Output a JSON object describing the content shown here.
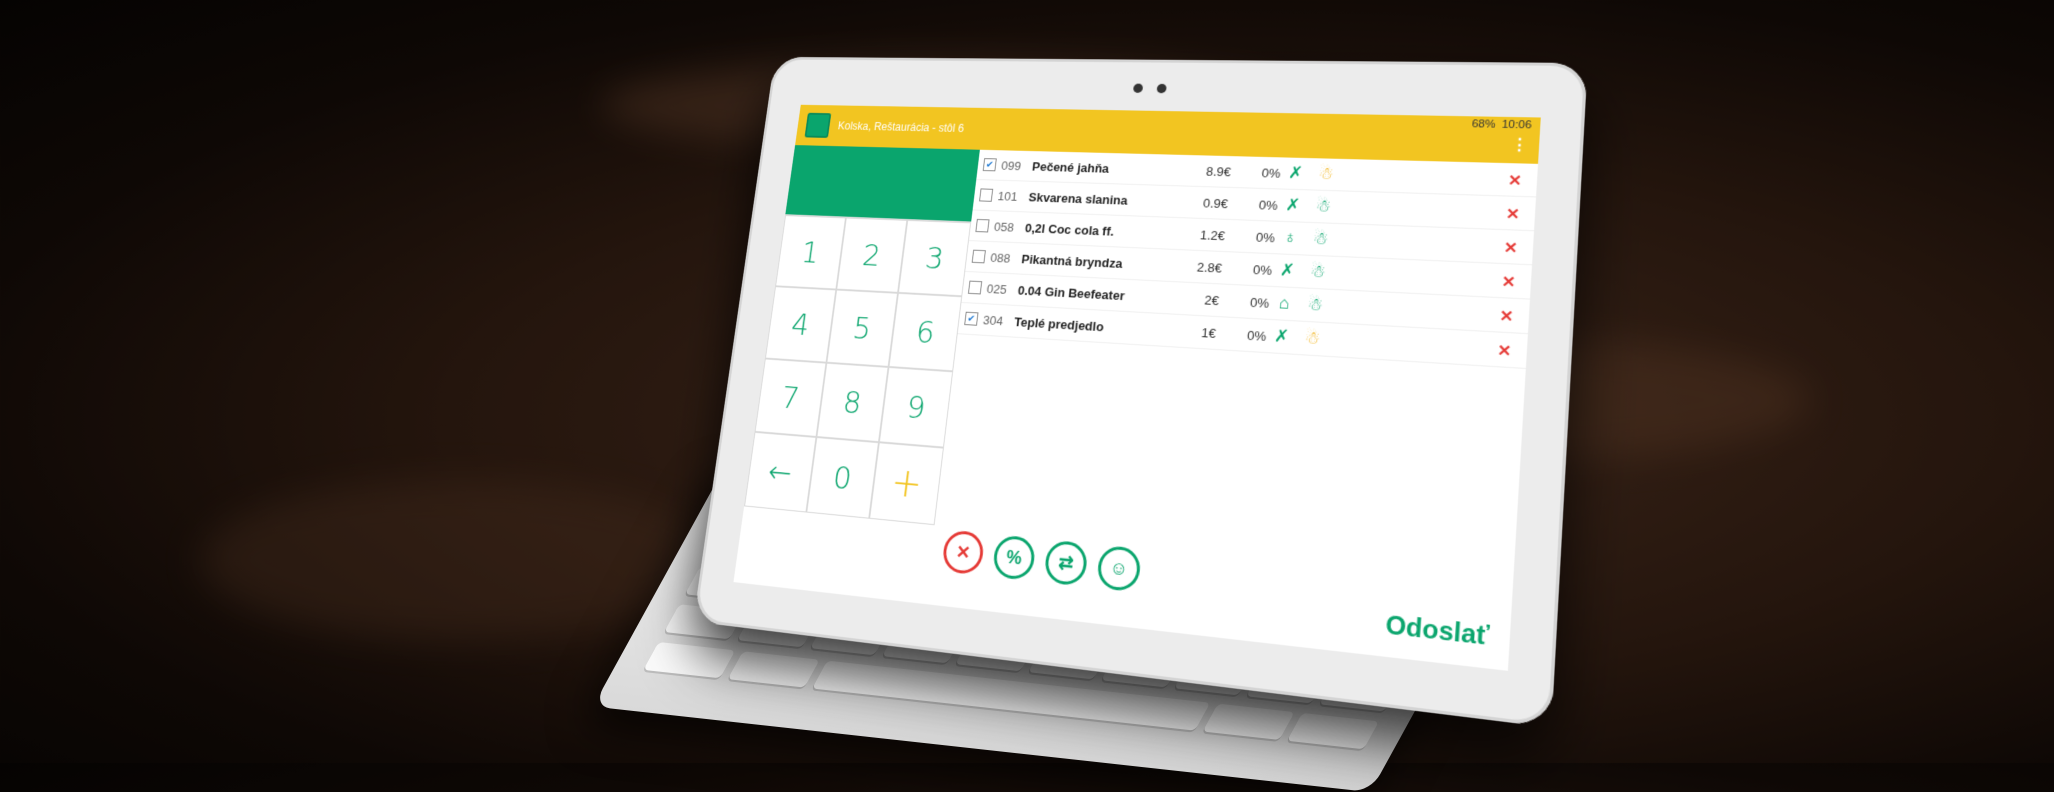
{
  "app": {
    "title": "Kolska, Reštaurácia - stôl 6",
    "time": "10:06",
    "battery": "68%",
    "menu_icon": "more-vert-icon"
  },
  "keypad": {
    "keys": [
      "1",
      "2",
      "3",
      "4",
      "5",
      "6",
      "7",
      "8",
      "9",
      "←",
      "0",
      "+"
    ]
  },
  "orders": [
    {
      "checked": true,
      "code": "099",
      "name": "Pečené jahňa",
      "price": "8.9€",
      "discount": "0%",
      "icons": [
        "fork-knife-icon",
        "person-yellow-icon"
      ]
    },
    {
      "checked": false,
      "code": "101",
      "name": "Skvarena slanina",
      "price": "0.9€",
      "discount": "0%",
      "icons": [
        "fork-knife-icon",
        "person-green-icon"
      ]
    },
    {
      "checked": false,
      "code": "058",
      "name": "0,2l Coc cola ff.",
      "price": "1.2€",
      "discount": "0%",
      "icons": [
        "glass-icon",
        "person-green-icon"
      ]
    },
    {
      "checked": false,
      "code": "088",
      "name": "Pikantná bryndza",
      "price": "2.8€",
      "discount": "0%",
      "icons": [
        "fork-knife-icon",
        "person-green-icon"
      ]
    },
    {
      "checked": false,
      "code": "025",
      "name": "0.04 Gin Beefeater",
      "price": "2€",
      "discount": "0%",
      "icons": [
        "cloche-icon",
        "person-green-icon"
      ]
    },
    {
      "checked": true,
      "code": "304",
      "name": "Teplé predjedlo",
      "price": "1€",
      "discount": "0%",
      "icons": [
        "fork-knife-icon",
        "person-yellow-icon"
      ]
    }
  ],
  "actions": [
    {
      "name": "cancel-icon",
      "glyph": "✕"
    },
    {
      "name": "percent-icon",
      "glyph": "%"
    },
    {
      "name": "transfer-icon",
      "glyph": "⇄"
    },
    {
      "name": "waiter-icon",
      "glyph": "☺"
    }
  ],
  "send_label": "Odoslať",
  "colors": {
    "accent_green": "#0aa56d",
    "bar_yellow": "#f2c521",
    "delete_red": "#e53935"
  }
}
